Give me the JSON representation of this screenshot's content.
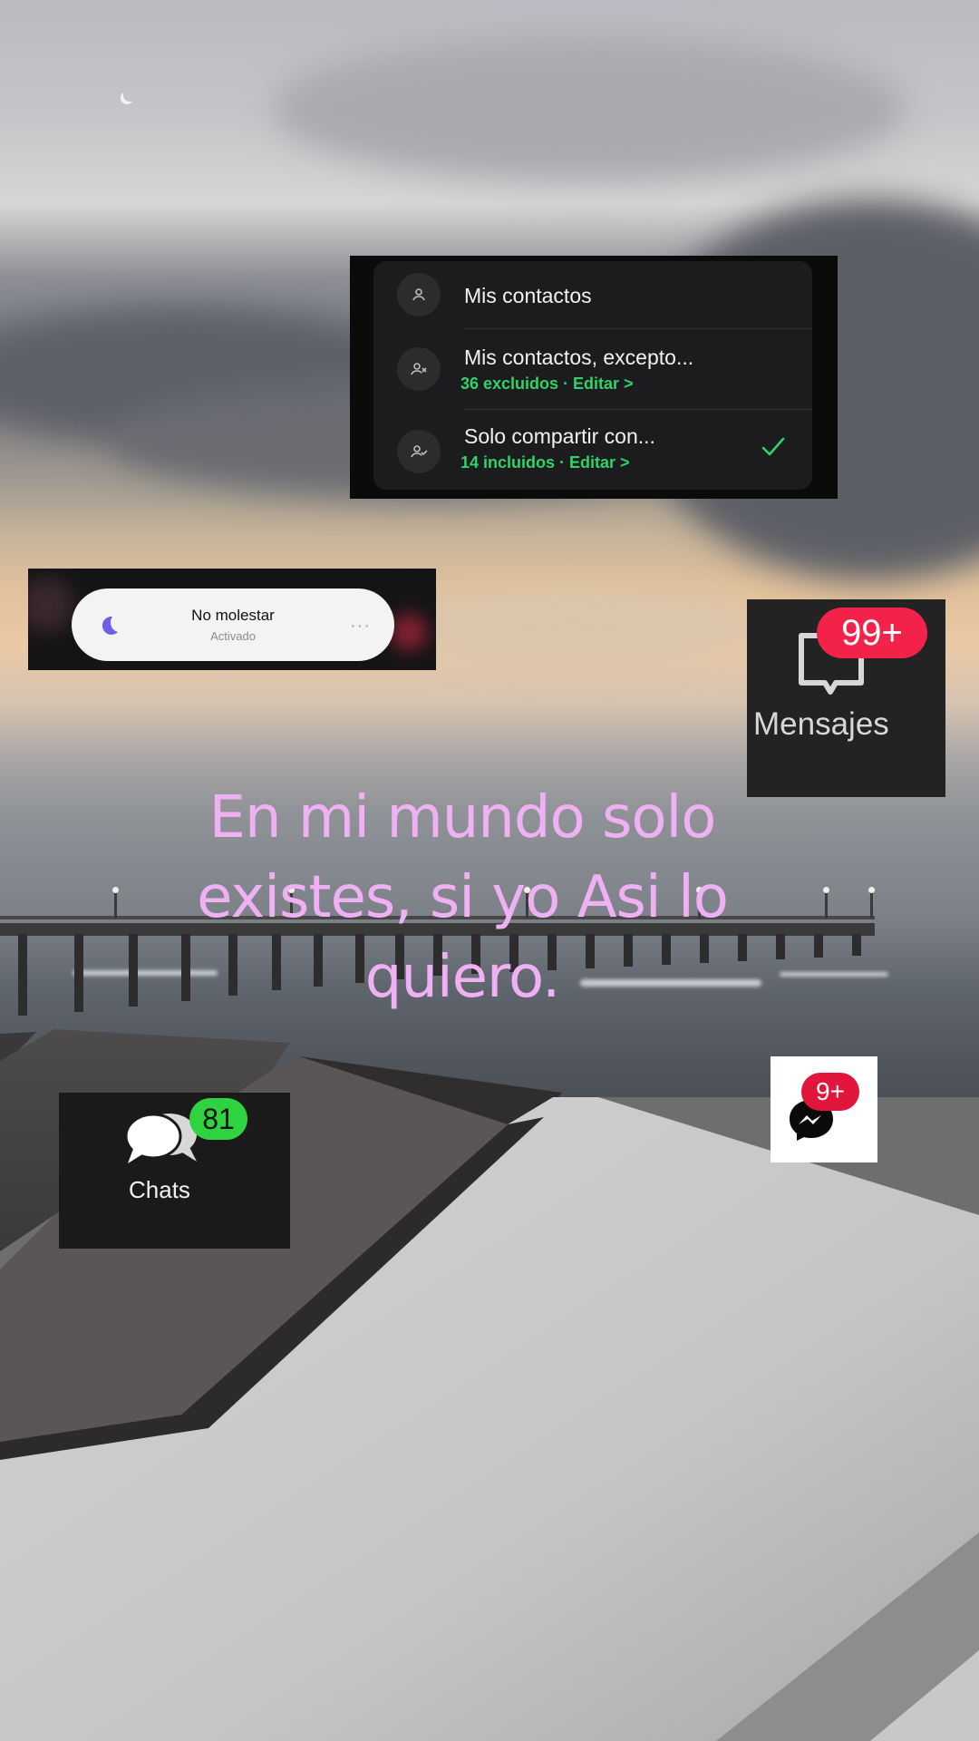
{
  "colors": {
    "accent_green": "#2fd366",
    "badge_red": "#f2224b",
    "badge_green": "#2fd33f",
    "caption_pink": "#f0b0f4"
  },
  "contacts_panel": {
    "options": [
      {
        "title": "Mis contactos",
        "subtitle": "",
        "icon": "person-icon"
      },
      {
        "title": "Mis contactos, excepto...",
        "subtitle": "36 excluidos · Editar >",
        "icon": "person-exclude-icon"
      },
      {
        "title": "Solo compartir con...",
        "subtitle": "14 incluidos · Editar >",
        "icon": "person-check-icon",
        "selected": true
      }
    ]
  },
  "dnd": {
    "title": "No molestar",
    "status": "Activado",
    "more": "···"
  },
  "mensajes": {
    "label": "Mensajes",
    "badge": "99+"
  },
  "chats": {
    "label": "Chats",
    "badge": "81"
  },
  "messenger": {
    "badge": "9+"
  },
  "caption": "En mi mundo solo existes, si yo Asi lo quiero."
}
